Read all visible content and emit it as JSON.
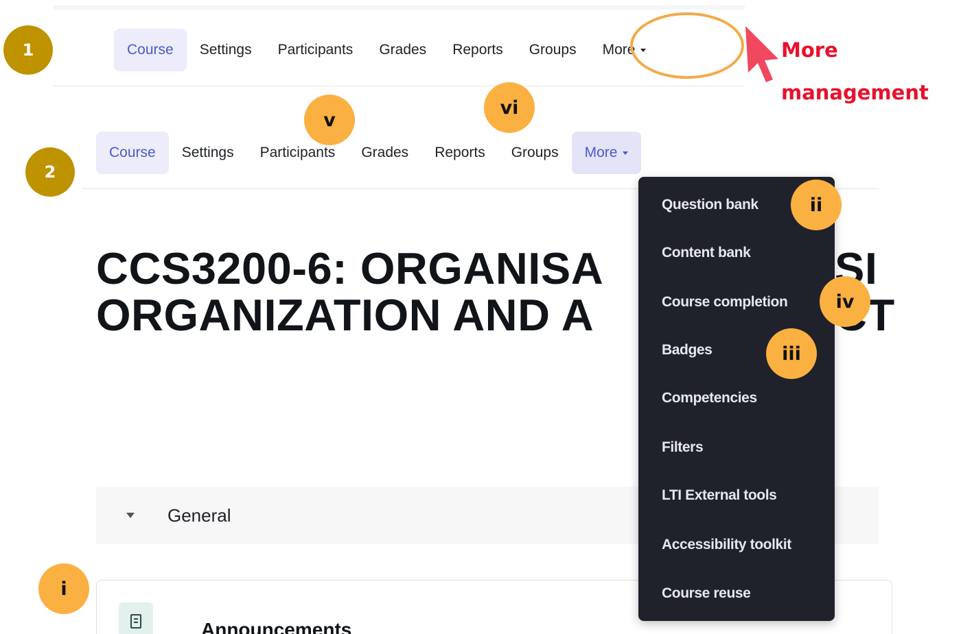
{
  "nav_top": {
    "items": [
      "Course",
      "Settings",
      "Participants",
      "Grades",
      "Reports",
      "Groups",
      "More"
    ]
  },
  "nav_bottom": {
    "items": [
      "Course",
      "Settings",
      "Participants",
      "Grades",
      "Reports",
      "Groups",
      "More"
    ]
  },
  "step_badges": [
    "1",
    "2"
  ],
  "callout": {
    "line1": "More",
    "line2": "management"
  },
  "markers": {
    "i": "i",
    "ii": "ii",
    "iii": "iii",
    "iv": "iv",
    "v": "v",
    "vi": "vi"
  },
  "course_title": {
    "line1": "CCS3200-6: ORGANISA",
    "line1_tail": "SI",
    "line2": "ORGANIZATION AND A",
    "line2_tail": "CT"
  },
  "section": {
    "label": "General"
  },
  "activity": {
    "name": "Announcements"
  },
  "more_menu": {
    "items": [
      "Question bank",
      "Content bank",
      "Course completion",
      "Badges",
      "Competencies",
      "Filters",
      "LTI External tools",
      "Accessibility toolkit",
      "Course reuse"
    ]
  },
  "colors": {
    "accent": "#4a5bc9",
    "active_tab_bg": "#ececfb",
    "step_badge": "#bf9200",
    "marker_badge": "#fbb042",
    "callout_red": "#e8112d",
    "menu_bg": "#1f222b"
  },
  "icons": [
    "caret-down-icon",
    "cursor-arrow-icon",
    "collapse-triangle-icon",
    "announcement-forum-icon"
  ]
}
